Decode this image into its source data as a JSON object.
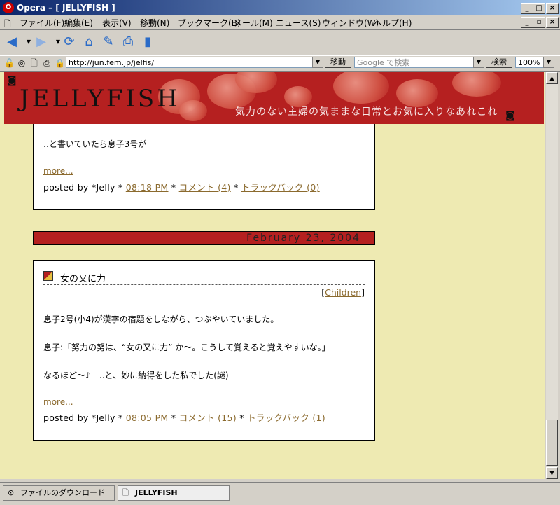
{
  "window": {
    "title": "Opera – [ JELLYFISH ]",
    "app_icon": "opera-icon"
  },
  "menu": {
    "items": [
      "ファイル(F)",
      "編集(E)",
      "表示(V)",
      "移動(N)",
      "ブックマーク(B)",
      "メール(M)",
      "ニュース(S)",
      "ウィンドウ(W)",
      "ヘルプ(H)"
    ]
  },
  "toolbar": {
    "icons": [
      "back-icon",
      "forward-icon",
      "reload-icon",
      "home-icon",
      "hotlist-icon",
      "print-icon",
      "page-icon"
    ]
  },
  "address": {
    "url": "http://jun.fem.jp/jelfis/",
    "go_label": "移動",
    "search_placeholder": "Google で検索",
    "search_label": "検索",
    "zoom": "100%"
  },
  "page": {
    "banner": {
      "logo": "JELLYFISH",
      "tagline": "気力のない主婦の気ままな日常とお気に入りなあれこれ"
    },
    "entry1": {
      "text": "‥と書いていたら息子3号が",
      "more": "more...",
      "posted_by": "posted by *Jelly *",
      "time": "08:18 PM",
      "sep1": "*",
      "comments": "コメント (4)",
      "sep2": "*",
      "trackback": "トラックバック (0)"
    },
    "date_header": "February 23, 2004",
    "entry2": {
      "title": "女の又に力",
      "category_open": "[",
      "category": "Children",
      "category_close": "]",
      "line1": "息子2号(小4)が漢字の宿題をしながら、つぶやいていました。",
      "line2": "息子:「努力の努は、“女の又に力” か～。こうして覚えると覚えやすいな。」",
      "line3": "なるほど～♪　‥と、妙に納得をした私でした(謎)",
      "more": "more...",
      "posted_by": "posted by *Jelly *",
      "time": "08:05 PM",
      "sep1": "*",
      "comments": "コメント (15)",
      "sep2": "*",
      "trackback": "トラックバック (1)"
    }
  },
  "tabs": [
    {
      "label": "ファイルのダウンロード",
      "icon": "download-icon"
    },
    {
      "label": "JELLYFISH",
      "icon": "page-icon"
    }
  ],
  "colors": {
    "banner": "#b52020",
    "page_bg": "#eeeab2",
    "link": "#8b6a2e"
  }
}
